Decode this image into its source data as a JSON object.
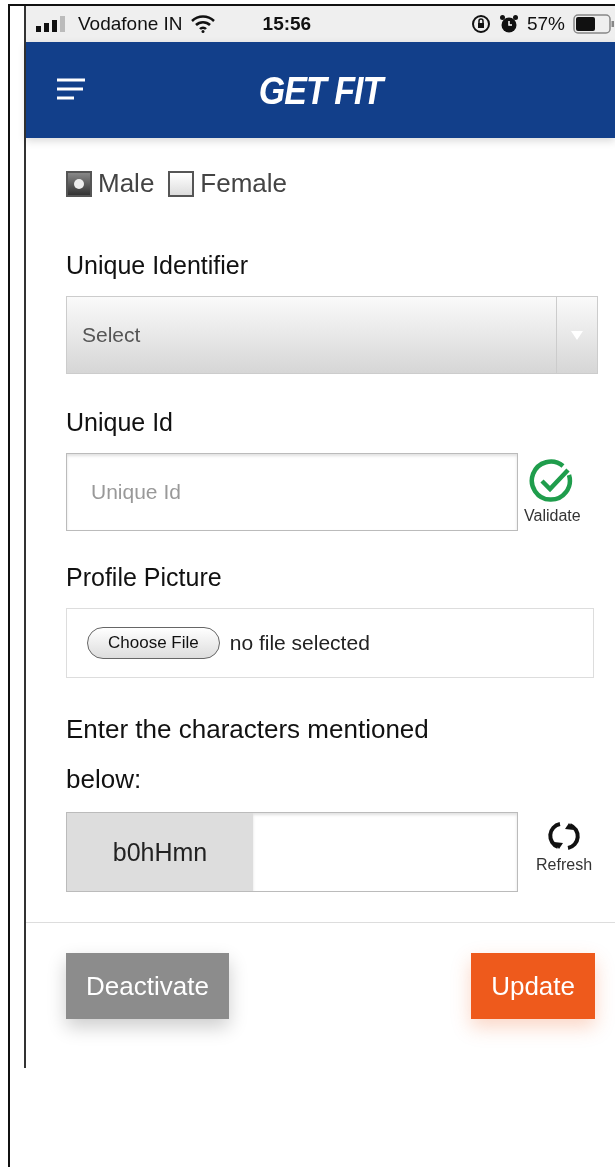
{
  "status_bar": {
    "carrier": "Vodafone IN",
    "time": "15:56",
    "battery": "57%"
  },
  "header": {
    "title": "GET FIT"
  },
  "gender": {
    "options": [
      {
        "label": "Male",
        "selected": true
      },
      {
        "label": "Female",
        "selected": false
      }
    ]
  },
  "unique_identifier": {
    "label": "Unique Identifier",
    "value": "Select"
  },
  "unique_id": {
    "label": "Unique Id",
    "placeholder": "Unique Id",
    "validate": "Validate"
  },
  "profile_picture": {
    "label": "Profile Picture",
    "button": "Choose File",
    "status": "no file selected"
  },
  "captcha": {
    "label": "Enter the characters mentioned below:",
    "code": "b0hHmn",
    "refresh": "Refresh"
  },
  "buttons": [
    {
      "label": "Deactivate",
      "kind": "secondary"
    },
    {
      "label": "Update",
      "kind": "primary"
    }
  ]
}
